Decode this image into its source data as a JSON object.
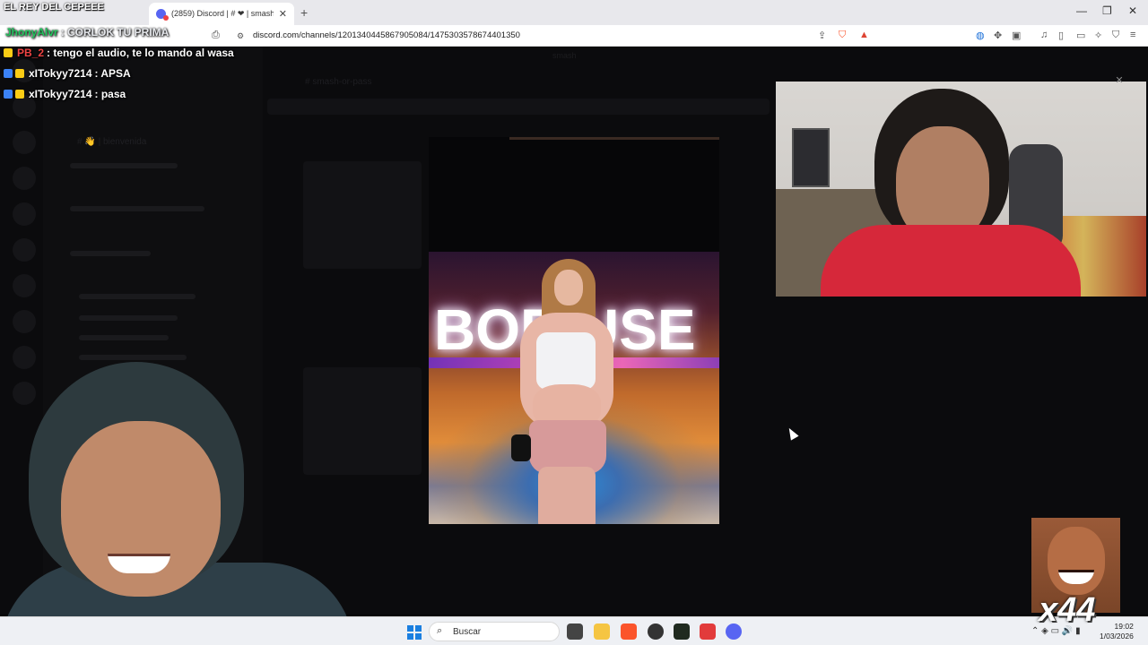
{
  "stream": {
    "title": "EL REY DEL CEPEEE",
    "chat": [
      {
        "user": "JhonyAlvr",
        "text": " : CORLOK TU PRIMA",
        "user_color": "#22c55e",
        "text_color": "#e5e7eb"
      },
      {
        "user": "PB_2",
        "text": " : tengo el audio, te lo mando al wasa",
        "user_color": "#ef4444",
        "text_color": "#ffffff"
      },
      {
        "user": "xITokyy7214",
        "text": " : APSA",
        "user_color": "#ffffff",
        "text_color": "#ffffff"
      },
      {
        "user": "xITokyy7214",
        "text": " : pasa",
        "user_color": "#ffffff",
        "text_color": "#ffffff"
      }
    ],
    "combo": "x44"
  },
  "browser": {
    "tab_title": "(2859) Discord | # ❤ | smash-or-",
    "url": "discord.com/channels/1201340445867905084/1475303578674401350"
  },
  "discord": {
    "server_name": "smash",
    "channel_header": "# smash-or-pass",
    "channel_welcome": "# 👋 | bienvenida",
    "media_sign": "BOR  USE"
  },
  "taskbar": {
    "search_placeholder": "Buscar",
    "time": "19:02",
    "date": "1/03/2026"
  },
  "colors": {
    "discord_blurple": "#5865f2",
    "brave_orange": "#fb542b",
    "taskbar_bg": "#eef0f4"
  }
}
